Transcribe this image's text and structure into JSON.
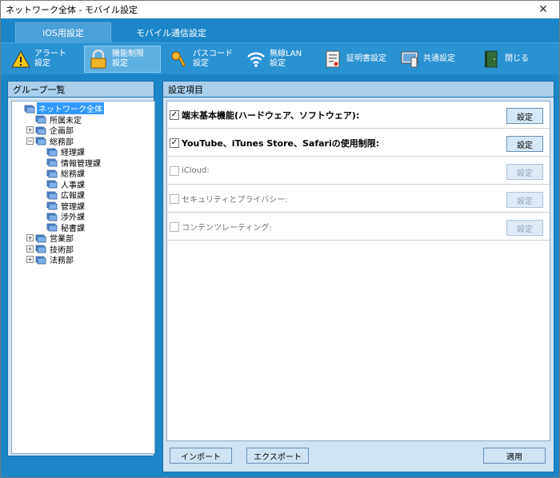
{
  "window": {
    "title": "ネットワーク全体 - モバイル設定",
    "close_glyph": "✕"
  },
  "tabs": [
    {
      "label": "iOS用設定",
      "active": true
    },
    {
      "label": "モバイル通信設定",
      "active": false
    }
  ],
  "toolbar": [
    {
      "label": "アラート\n設定",
      "icon": "warning-icon"
    },
    {
      "label": "機能制限\n設定",
      "icon": "lock-icon",
      "active": true
    },
    {
      "label": "パスコード\n設定",
      "icon": "key-icon"
    },
    {
      "label": "無線LAN\n設定",
      "icon": "wifi-icon"
    },
    {
      "label": "証明書設定",
      "icon": "certificate-icon"
    },
    {
      "label": "共通設定",
      "icon": "common-settings-icon"
    },
    {
      "label": "閉じる",
      "icon": "door-icon"
    }
  ],
  "group_panel": {
    "title": "グループ一覧",
    "tree": [
      {
        "label": "ネットワーク全体",
        "level": 0,
        "expander": "",
        "selected": true
      },
      {
        "label": "所属未定",
        "level": 1,
        "expander": ""
      },
      {
        "label": "企画部",
        "level": 1,
        "expander": "+"
      },
      {
        "label": "総務部",
        "level": 1,
        "expander": "−"
      },
      {
        "label": "経理課",
        "level": 2,
        "expander": ""
      },
      {
        "label": "情報管理課",
        "level": 2,
        "expander": ""
      },
      {
        "label": "総務課",
        "level": 2,
        "expander": ""
      },
      {
        "label": "人事課",
        "level": 2,
        "expander": ""
      },
      {
        "label": "広報課",
        "level": 2,
        "expander": ""
      },
      {
        "label": "管理課",
        "level": 2,
        "expander": ""
      },
      {
        "label": "渉外課",
        "level": 2,
        "expander": ""
      },
      {
        "label": "秘書課",
        "level": 2,
        "expander": ""
      },
      {
        "label": "営業部",
        "level": 1,
        "expander": "+"
      },
      {
        "label": "技術部",
        "level": 1,
        "expander": "+"
      },
      {
        "label": "法務部",
        "level": 1,
        "expander": "+"
      }
    ]
  },
  "settings_panel": {
    "title": "設定項目",
    "items": [
      {
        "label": "端末基本機能(ハードウェア、ソフトウェア):",
        "checked": true,
        "enabled": true,
        "button": "設定"
      },
      {
        "label": "YouTube、iTunes Store、Safariの使用制限:",
        "checked": true,
        "enabled": true,
        "button": "設定"
      },
      {
        "label": "iCloud:",
        "checked": false,
        "enabled": false,
        "button": "設定"
      },
      {
        "label": "セキュリティとプライバシー:",
        "checked": false,
        "enabled": false,
        "button": "設定"
      },
      {
        "label": "コンテンツレーティング:",
        "checked": false,
        "enabled": false,
        "button": "設定"
      }
    ],
    "import_label": "インポート",
    "export_label": "エクスポート",
    "apply_label": "適用"
  },
  "colors": {
    "chrome": "#1d86c8",
    "panel": "#cfe3f3",
    "selection": "#3399ff"
  }
}
